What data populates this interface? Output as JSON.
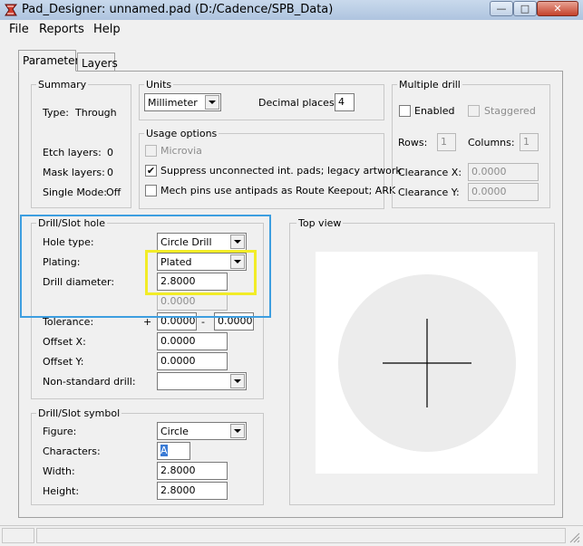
{
  "window": {
    "title": "Pad_Designer: unnamed.pad (D:/Cadence/SPB_Data)",
    "minimize": "—",
    "maximize": "□",
    "close": "✕"
  },
  "menu": [
    "File",
    "Reports",
    "Help"
  ],
  "tabs": [
    "Parameters",
    "Layers"
  ],
  "summary": {
    "title": "Summary",
    "type_label": "Type:",
    "type_value": "Through",
    "etch_label": "Etch layers:",
    "etch_value": "0",
    "mask_label": "Mask layers:",
    "mask_value": "0",
    "mode_label": "Single Mode:",
    "mode_value": "Off"
  },
  "units": {
    "title": "Units",
    "unit": "Millimeter",
    "decimal_label": "Decimal places:",
    "decimal_value": "4"
  },
  "usage": {
    "title": "Usage options",
    "microvia": "Microvia",
    "suppress": "Suppress unconnected int. pads; legacy artwork",
    "mech": "Mech pins use antipads as Route Keepout; ARK"
  },
  "multi_drill": {
    "title": "Multiple drill",
    "enabled": "Enabled",
    "staggered": "Staggered",
    "rows_label": "Rows:",
    "rows_value": "1",
    "cols_label": "Columns:",
    "cols_value": "1",
    "clrx_label": "Clearance X:",
    "clrx_value": "0.0000",
    "clry_label": "Clearance Y:",
    "clry_value": "0.0000"
  },
  "drill_hole": {
    "title": "Drill/Slot hole",
    "hole_type_label": "Hole type:",
    "hole_type": "Circle Drill",
    "plating_label": "Plating:",
    "plating": "Plated",
    "diameter_label": "Drill diameter:",
    "diameter": "2.8000",
    "second_value": "0.0000",
    "tolerance_label": "Tolerance:",
    "tol_plus": "+",
    "tol_plus_value": "0.0000",
    "tol_minus": "-",
    "tol_minus_value": "0.0000",
    "offx_label": "Offset X:",
    "offx": "0.0000",
    "offy_label": "Offset Y:",
    "offy": "0.0000",
    "nonstd_label": "Non-standard drill:",
    "nonstd": ""
  },
  "drill_symbol": {
    "title": "Drill/Slot symbol",
    "figure_label": "Figure:",
    "figure": "Circle",
    "chars_label": "Characters:",
    "chars": "A",
    "width_label": "Width:",
    "width": "2.8000",
    "height_label": "Height:",
    "height": "2.8000"
  },
  "top_view": {
    "title": "Top view"
  },
  "colors": {
    "highlight_blue": "#3d9ee0",
    "highlight_yellow": "#f2ec27",
    "pad_fill": "#ececec"
  }
}
